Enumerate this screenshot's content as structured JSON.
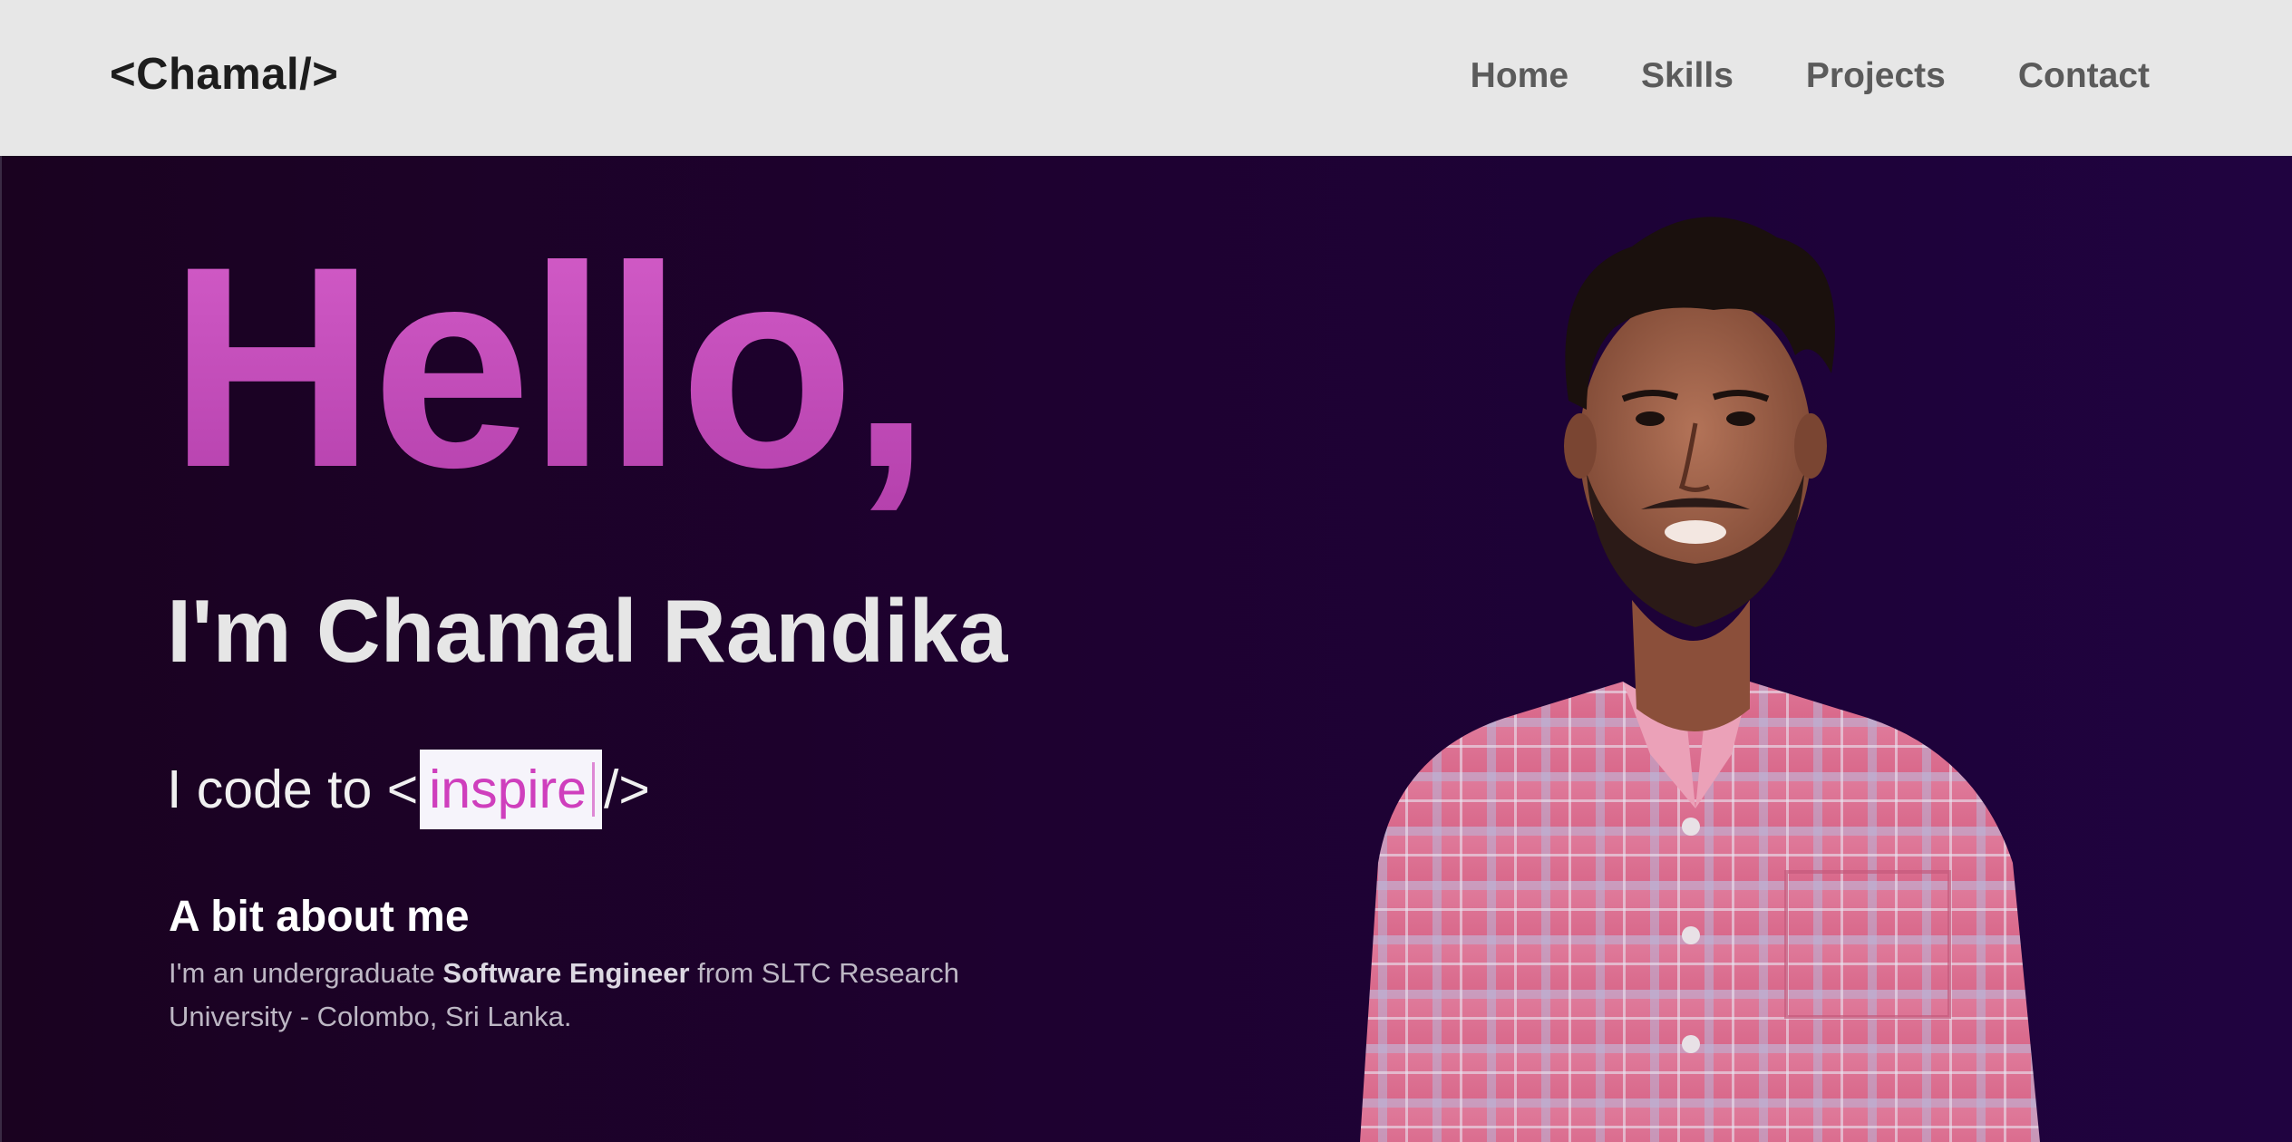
{
  "header": {
    "logo": "<Chamal/>",
    "nav": [
      "Home",
      "Skills",
      "Projects",
      "Contact"
    ]
  },
  "hero": {
    "greeting": "Hello,",
    "name_line": "I'm Chamal Randika",
    "code_prefix": "I code to <",
    "code_word": "inspire",
    "code_suffix": "/>",
    "about_title": "A bit about me",
    "about_text_1": "I'm an undergraduate ",
    "about_text_bold": "Software Engineer",
    "about_text_2": " from SLTC Research University - Colombo, Sri Lanka.",
    "portrait_alt": "portrait-photo"
  },
  "colors": {
    "header_bg": "#e7e7e7",
    "hero_bg": "#1e0130",
    "accent": "#c84ebc",
    "nav_text": "#5b5b5b"
  }
}
